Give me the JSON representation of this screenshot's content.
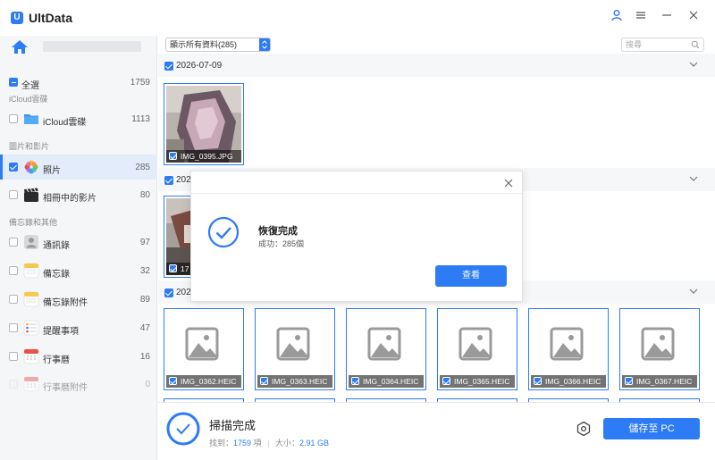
{
  "app": {
    "title": "UltData",
    "logo_letter": "U"
  },
  "window": {
    "icons": [
      "user-icon",
      "menu-icon",
      "minimize-icon",
      "close-icon"
    ]
  },
  "sidebar": {
    "select_all": {
      "label": "全選",
      "count": "1759"
    },
    "sections": [
      {
        "header": "iCloud雲碟",
        "items": [
          {
            "label": "iCloud雲碟",
            "count": "1113",
            "icon": "folder-icon"
          }
        ]
      },
      {
        "header": "圖片和影片",
        "items": [
          {
            "label": "照片",
            "count": "285",
            "icon": "photos-icon",
            "selected": true
          },
          {
            "label": "相冊中的影片",
            "count": "80",
            "icon": "video-icon"
          }
        ]
      },
      {
        "header": "備忘錄和其他",
        "items": [
          {
            "label": "通訊錄",
            "count": "97",
            "icon": "contacts-icon"
          },
          {
            "label": "備忘錄",
            "count": "32",
            "icon": "notes-icon"
          },
          {
            "label": "備忘錄附件",
            "count": "89",
            "icon": "notes-attachment-icon"
          },
          {
            "label": "提醒事項",
            "count": "47",
            "icon": "reminders-icon"
          },
          {
            "label": "行事曆",
            "count": "16",
            "icon": "calendar-icon"
          },
          {
            "label": "行事曆附件",
            "count": "0",
            "icon": "calendar-attachment-icon",
            "disabled": true
          }
        ]
      }
    ]
  },
  "toolbar": {
    "filter_value": "顯示所有資料(285)",
    "search_placeholder": "搜尋"
  },
  "groups": [
    {
      "date": "2026-07-09",
      "files": [
        "IMG_0395.JPG"
      ]
    },
    {
      "date": "2026",
      "files": [
        "17"
      ]
    },
    {
      "date": "2026",
      "files": [
        "IMG_0362.HEIC",
        "IMG_0363.HEIC",
        "IMG_0364.HEIC",
        "IMG_0365.HEIC",
        "IMG_0366.HEIC",
        "IMG_0367.HEIC"
      ]
    }
  ],
  "bottombar": {
    "title": "掃描完成",
    "found_label": "找到：",
    "found_count": "1759",
    "found_unit": " 項",
    "size_label": "大小：",
    "size_value": "2.91 GB",
    "save_label": "儲存至 PC"
  },
  "modal": {
    "title": "恢復完成",
    "subtitle": "成功：285個",
    "button_label": "查看"
  },
  "colors": {
    "accent": "#2d7cf6",
    "sidebar_bg": "#f5f6f8",
    "selected_bg": "#e3ecfb"
  }
}
